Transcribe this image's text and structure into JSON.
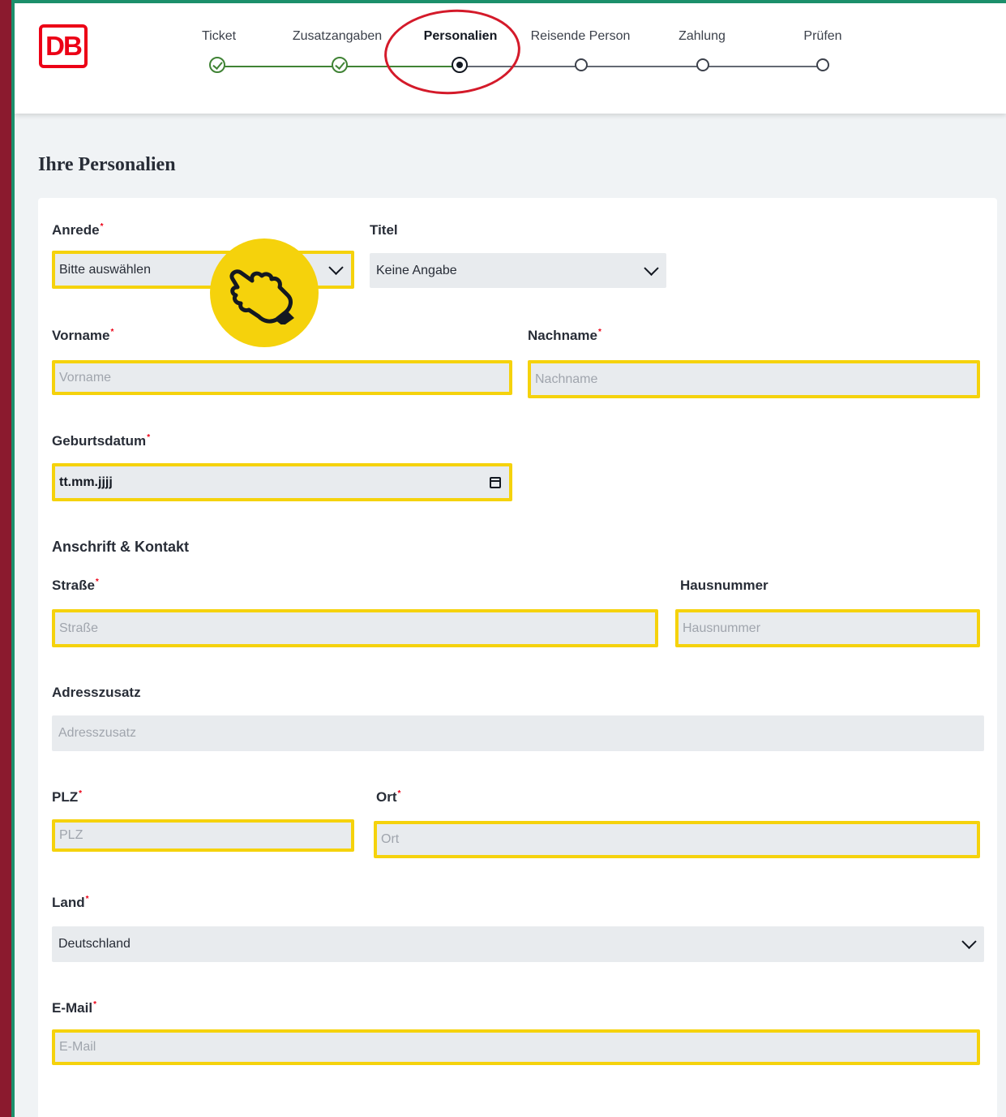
{
  "logo": "DB",
  "progress": {
    "steps": [
      {
        "label": "Ticket",
        "state": "done"
      },
      {
        "label": "Zusatzangaben",
        "state": "done"
      },
      {
        "label": "Personalien",
        "state": "current"
      },
      {
        "label": "Reisende Person",
        "state": "todo"
      },
      {
        "label": "Zahlung",
        "state": "todo"
      },
      {
        "label": "Prüfen",
        "state": "todo"
      }
    ]
  },
  "page_title": "Ihre Personalien",
  "form": {
    "anrede": {
      "label": "Anrede",
      "value": "Bitte auswählen"
    },
    "titel": {
      "label": "Titel",
      "value": "Keine Angabe"
    },
    "vorname": {
      "label": "Vorname",
      "placeholder": "Vorname"
    },
    "nachname": {
      "label": "Nachname",
      "placeholder": "Nachname"
    },
    "geburtsdatum": {
      "label": "Geburtsdatum",
      "placeholder": "tt.mm.jjjj"
    },
    "anschrift_title": "Anschrift & Kontakt",
    "strasse": {
      "label": "Straße",
      "placeholder": "Straße"
    },
    "hausnummer": {
      "label": "Hausnummer",
      "placeholder": "Hausnummer"
    },
    "adresszusatz": {
      "label": "Adresszusatz",
      "placeholder": "Adresszusatz"
    },
    "plz": {
      "label": "PLZ",
      "placeholder": "PLZ"
    },
    "ort": {
      "label": "Ort",
      "placeholder": "Ort"
    },
    "land": {
      "label": "Land",
      "value": "Deutschland"
    },
    "email": {
      "label": "E-Mail",
      "placeholder": "E-Mail"
    }
  },
  "colors": {
    "db_red": "#ec0016",
    "highlight": "#f5d20c",
    "done_green": "#408335",
    "annotation_red": "#d41a2a"
  },
  "icons": [
    "check-icon",
    "chevron-down-icon",
    "calendar-icon",
    "pointing-hand-icon"
  ]
}
